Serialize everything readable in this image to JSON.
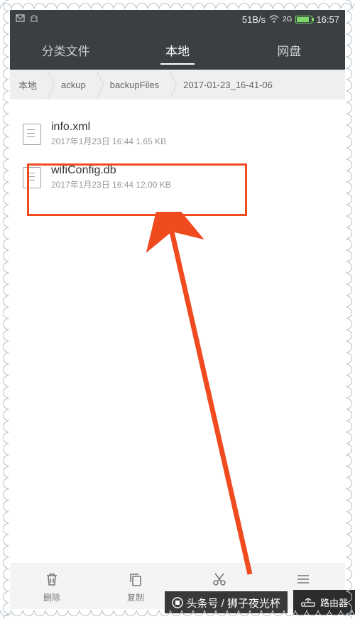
{
  "statusbar": {
    "speed": "51B/s",
    "net_label": "2G",
    "time": "16:57"
  },
  "tabs": [
    {
      "label": "分类文件",
      "active": false
    },
    {
      "label": "本地",
      "active": true
    },
    {
      "label": "网盘",
      "active": false
    }
  ],
  "breadcrumb": [
    "本地",
    "ackup",
    "backupFiles",
    "2017-01-23_16-41-06"
  ],
  "files": [
    {
      "name": "info.xml",
      "meta": "2017年1月23日 16:44 1.65 KB"
    },
    {
      "name": "wifiConfig.db",
      "meta": "2017年1月23日 16:44 12.00 KB"
    }
  ],
  "toolbar": [
    {
      "key": "delete",
      "label": "删除"
    },
    {
      "key": "copy",
      "label": "复制"
    },
    {
      "key": "cut",
      "label": "剪切"
    },
    {
      "key": "more",
      "label": "更多"
    }
  ],
  "overlay": {
    "source": "头条号 / 狮子夜光杯",
    "badge": "路由器"
  },
  "colors": {
    "accent": "#f04b1f",
    "header_bg": "#3a3f42"
  }
}
